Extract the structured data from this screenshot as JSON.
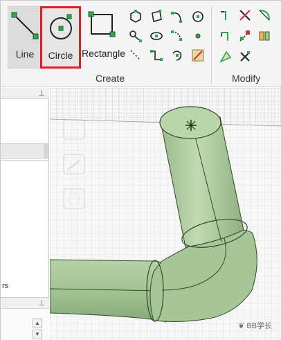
{
  "ribbon": {
    "buttons": {
      "line": "Line",
      "circle": "Circle",
      "rectangle": "Rectangle"
    },
    "groups": {
      "create": "Create",
      "modify": "Modify"
    }
  },
  "watermark": {
    "text": "BB学长"
  },
  "colors": {
    "highlight_border": "#e02020",
    "tube_fill": "#a9c99a",
    "tube_stroke": "#2f4a2a",
    "grid_line": "#b7b0c9"
  }
}
